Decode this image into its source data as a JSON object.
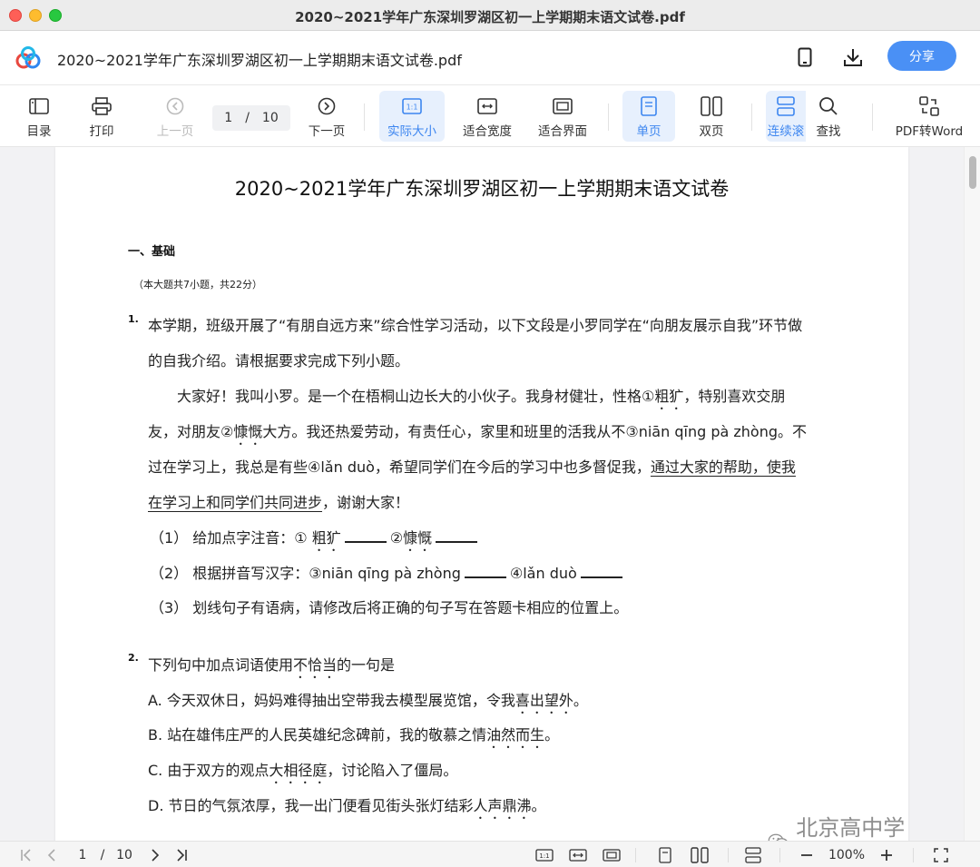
{
  "window": {
    "title": "2020~2021学年广东深圳罗湖区初一上学期期末语文试卷.pdf"
  },
  "header": {
    "doc_name": "2020~2021学年广东深圳罗湖区初一上学期期末语文试卷.pdf",
    "share_label": "分享",
    "icons": [
      "app-logo-icon",
      "phone-icon",
      "download-icon"
    ]
  },
  "toolbar": {
    "toc": "目录",
    "print": "打印",
    "prev": "上一页",
    "page_current": "1",
    "page_sep": "/",
    "page_total": "10",
    "next": "下一页",
    "actual_size": "实际大小",
    "fit_width": "适合宽度",
    "fit_page": "适合界面",
    "single": "单页",
    "double": "双页",
    "continuous": "连续滚",
    "find": "查找",
    "pdf_to_word": "PDF转Word"
  },
  "doc": {
    "title": "2020~2021学年广东深圳罗湖区初一上学期期末语文试卷",
    "section": "一、基础",
    "section_note": "（本大题共7小题，共22分）",
    "q1": {
      "num": "1.",
      "l1": "本学期，班级开展了“有朋自远方来”综合性学习活动，以下文段是小罗同学在“向朋友展示自我”环节做",
      "l2": "的自我介绍。请根据要求完成下列小题。",
      "p1a": "大家好！我叫小罗。是一个在梧桐山边长大的小伙子。我身材健壮，性格①",
      "p1b": "粗犷",
      "p1c": "，特别喜欢交朋",
      "p2a": "友，对朋友②",
      "p2b": "慷慨",
      "p2c": "大方。我还热爱劳动，有责任心，家里和班里的活我从不③niān qīng pà zhòng。不",
      "p3a": "过在学习上，我总是有些④lǎn duò，希望同学们在今后的学习中也多督促我，",
      "p3b": "通过大家的帮助，使我",
      "p4a": "在学习上和同学们共同进步",
      "p4b": "，谢谢大家！",
      "s1a": "（1） 给加点字注音：①",
      "s1b": "粗犷",
      "s1c": "②",
      "s1d": "慷慨",
      "s2a": "（2） 根据拼音写汉字：③niān qīng pà zhòng",
      "s2b": "④lǎn duò",
      "s3": "（3） 划线句子有语病，请修改后将正确的句子写在答题卡相应的位置上。"
    },
    "q2": {
      "num": "2.",
      "stem_a": "下列句中加点词语使用",
      "stem_b": "不恰当",
      "stem_c": "的一句是",
      "a_a": "A. 今天双休日，妈妈难得抽出空带我去模型展览馆，令我",
      "a_b": "喜出望外",
      "a_c": "。",
      "b_a": "B. 站在雄伟庄严的人民英雄纪念碑前，我的敬慕之情",
      "b_b": "油然而生",
      "b_c": "。",
      "c_a": "C. 由于双方的观点",
      "c_b": "大相径庭",
      "c_c": "，讨论陷入了僵局。",
      "d_a": "D. 节日的气氛浓厚，我一出门便看见街头张灯结彩",
      "d_b": "人声鼎沸",
      "d_c": "。"
    },
    "watermark": "北京高中学习资料"
  },
  "statusbar": {
    "page_current": "1",
    "page_sep": "/",
    "page_total": "10",
    "zoom": "100%"
  },
  "colors": {
    "accent": "#4a90f5",
    "active_bg": "#e7f0fd",
    "active_text": "#3d86f0"
  }
}
